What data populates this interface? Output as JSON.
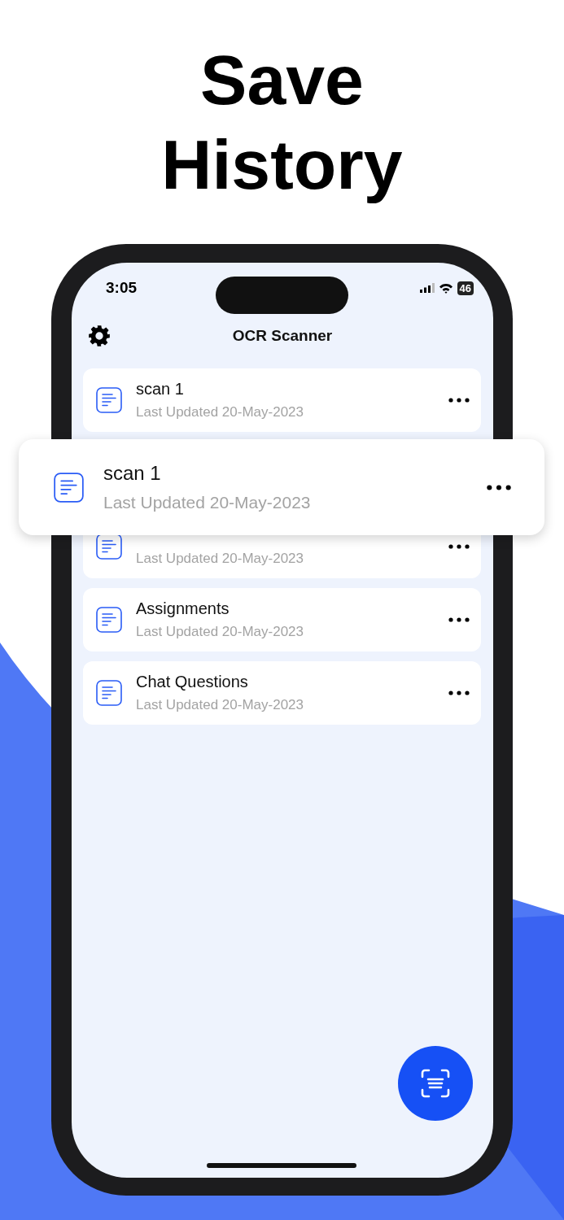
{
  "headline": [
    "Save",
    "History"
  ],
  "status_bar": {
    "time": "3:05",
    "battery": "46"
  },
  "app_bar": {
    "title": "OCR Scanner"
  },
  "documents": [
    {
      "kind": "document",
      "title": "scan 1",
      "subtitle": "Last Updated 20-May-2023"
    },
    {
      "kind": "placeholder"
    },
    {
      "kind": "document",
      "subtitle": "Last Updated 20-May-2023"
    },
    {
      "kind": "document",
      "title": "Assignments",
      "subtitle": "Last Updated 20-May-2023"
    },
    {
      "kind": "document",
      "title": "Chat Questions",
      "subtitle": "Last Updated 20-May-2023"
    }
  ],
  "dragged_item": {
    "title": "scan 1",
    "subtitle": "Last Updated 20-May-2023"
  }
}
